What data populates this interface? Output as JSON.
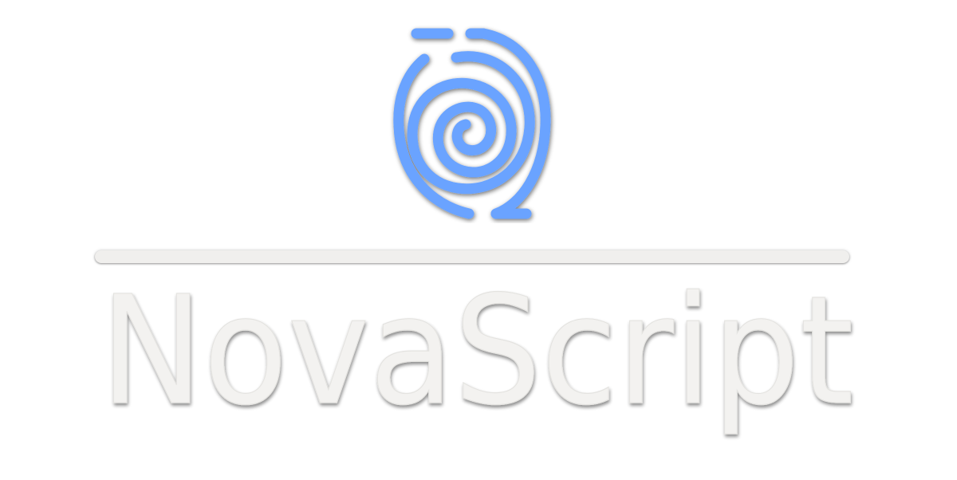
{
  "brand": {
    "name": "NovaScript"
  },
  "logo": {
    "icon": "spiral-icon",
    "color": "#6aa3ff"
  },
  "divider": {
    "color": "#f0efed"
  },
  "wordmark": {
    "color": "#f3f2f0"
  }
}
